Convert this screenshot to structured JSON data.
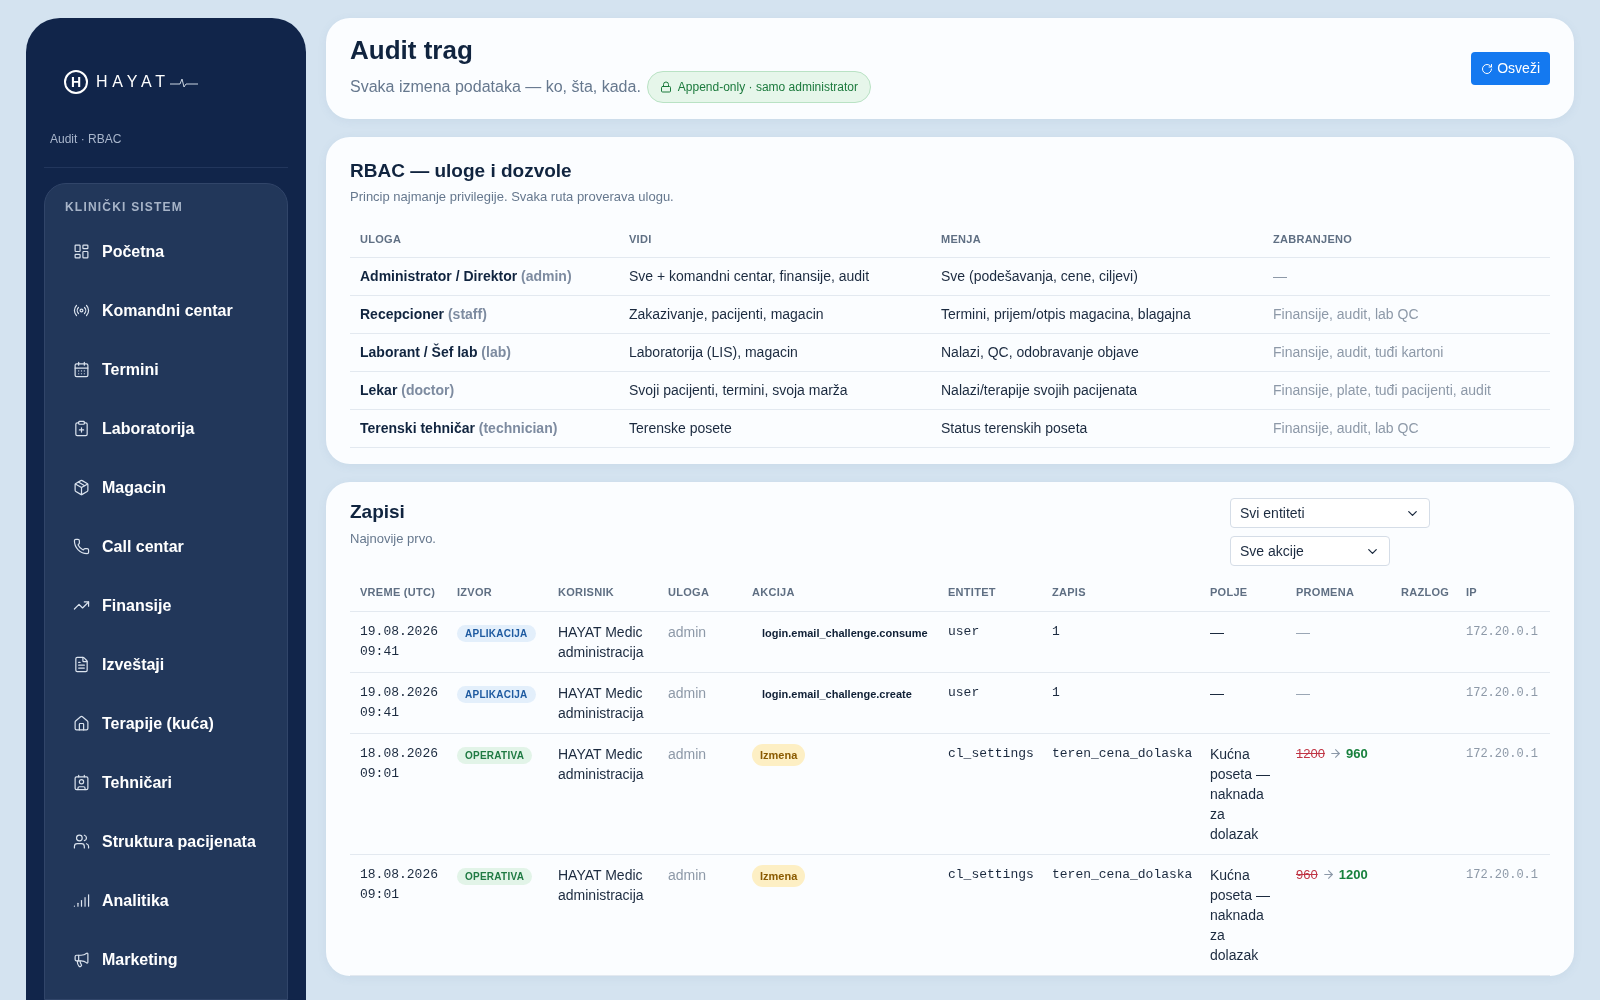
{
  "sidebar": {
    "logo": {
      "mark": "H",
      "name": "HAYAT"
    },
    "subtitle": "Audit · RBAC",
    "section": "KLINIČKI SISTEM",
    "items": [
      {
        "label": "Početna"
      },
      {
        "label": "Komandni centar"
      },
      {
        "label": "Termini"
      },
      {
        "label": "Laboratorija"
      },
      {
        "label": "Magacin"
      },
      {
        "label": "Call centar"
      },
      {
        "label": "Finansije"
      },
      {
        "label": "Izveštaji"
      },
      {
        "label": "Terapije (kuća)"
      },
      {
        "label": "Tehničari"
      },
      {
        "label": "Struktura pacijenata"
      },
      {
        "label": "Analitika"
      },
      {
        "label": "Marketing"
      }
    ]
  },
  "header": {
    "title": "Audit trag",
    "subtitle": "Svaka izmena podataka — ko, šta, kada.",
    "badge": "Append-only · samo administrator",
    "refresh_button": "Osveži"
  },
  "rbac": {
    "title": "RBAC — uloge i dozvole",
    "subtitle": "Princip najmanje privilegije. Svaka ruta proverava ulogu.",
    "columns": [
      "ULOGA",
      "VIDI",
      "MENJA",
      "ZABRANJENO"
    ],
    "rows": [
      {
        "role": "Administrator / Direktor",
        "code": "(admin)",
        "sees": "Sve + komandni centar, finansije, audit",
        "edits": "Sve (podešavanja, cene, ciljevi)",
        "forbidden": "—"
      },
      {
        "role": "Recepcioner",
        "code": "(staff)",
        "sees": "Zakazivanje, pacijenti, magacin",
        "edits": "Termini, prijem/otpis magacina, blagajna",
        "forbidden": "Finansije, audit, lab QC"
      },
      {
        "role": "Laborant / Šef lab",
        "code": "(lab)",
        "sees": "Laboratorija (LIS), magacin",
        "edits": "Nalazi, QC, odobravanje objave",
        "forbidden": "Finansije, audit, tuđi kartoni"
      },
      {
        "role": "Lekar",
        "code": "(doctor)",
        "sees": "Svoji pacijenti, termini, svoja marža",
        "edits": "Nalazi/terapije svojih pacijenata",
        "forbidden": "Finansije, plate, tuđi pacijenti, audit"
      },
      {
        "role": "Terenski tehničar",
        "code": "(technician)",
        "sees": "Terenske posete",
        "edits": "Status terenskih poseta",
        "forbidden": "Finansije, audit, lab QC"
      }
    ]
  },
  "log": {
    "title": "Zapisi",
    "subtitle": "Najnovije prvo.",
    "filters": [
      "Svi entiteti",
      "Sve akcije"
    ],
    "columns": [
      "VREME (UTC)",
      "IZVOR",
      "KORISNIK",
      "ULOGA",
      "AKCIJA",
      "ENTITET",
      "ZAPIS",
      "POLJE",
      "PROMENA",
      "RAZLOG",
      "IP"
    ],
    "rows": [
      {
        "date": "19.08.2026",
        "time": "09:41",
        "source": {
          "label": "APLIKACIJA",
          "kind": "app"
        },
        "user": "HAYAT Medic administracija",
        "role": "admin",
        "action": {
          "label": "login.email_challenge.consume",
          "kind": "code"
        },
        "entity": "user",
        "record": "1",
        "field": "—",
        "change": {
          "kind": "none",
          "text": "—"
        },
        "ip": "172.20.0.1"
      },
      {
        "date": "19.08.2026",
        "time": "09:41",
        "source": {
          "label": "APLIKACIJA",
          "kind": "app"
        },
        "user": "HAYAT Medic administracija",
        "role": "admin",
        "action": {
          "label": "login.email_challenge.create",
          "kind": "code"
        },
        "entity": "user",
        "record": "1",
        "field": "—",
        "change": {
          "kind": "none",
          "text": "—"
        },
        "ip": "172.20.0.1"
      },
      {
        "date": "18.08.2026",
        "time": "09:01",
        "source": {
          "label": "OPERATIVA",
          "kind": "ops"
        },
        "user": "HAYAT Medic administracija",
        "role": "admin",
        "action": {
          "label": "Izmena",
          "kind": "badge"
        },
        "entity": "cl_settings",
        "record": "teren_cena_dolaska",
        "field": "Kućna poseta — naknada za dolazak",
        "change": {
          "kind": "diff",
          "old": "1200",
          "new": "960"
        },
        "ip": "172.20.0.1"
      },
      {
        "date": "18.08.2026",
        "time": "09:01",
        "source": {
          "label": "OPERATIVA",
          "kind": "ops"
        },
        "user": "HAYAT Medic administracija",
        "role": "admin",
        "action": {
          "label": "Izmena",
          "kind": "badge"
        },
        "entity": "cl_settings",
        "record": "teren_cena_dolaska",
        "field": "Kućna poseta — naknada za dolazak",
        "change": {
          "kind": "diff",
          "old": "960",
          "new": "1200"
        },
        "ip": "172.20.0.1"
      }
    ]
  }
}
